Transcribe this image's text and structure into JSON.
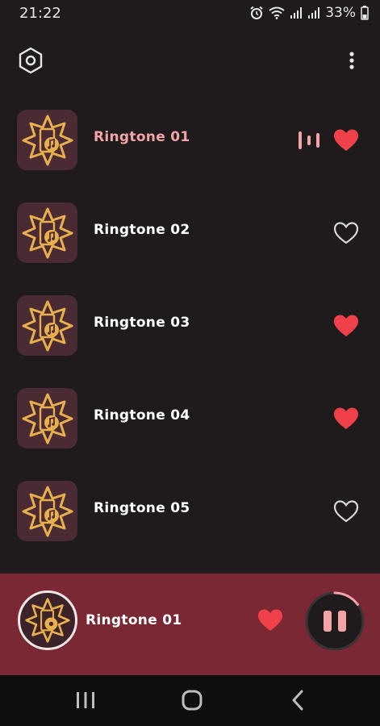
{
  "status_bar": {
    "time": "21:22",
    "battery": "33%",
    "icons": [
      "alarm-icon",
      "wifi-icon",
      "signal-icon",
      "signal-icon",
      "battery-icon"
    ]
  },
  "toolbar": {
    "settings_icon": "settings-hexagon-icon",
    "menu_icon": "more-vertical-icon"
  },
  "ringtones": [
    {
      "title": "Ringtone 01",
      "favorite": true,
      "playing": true
    },
    {
      "title": "Ringtone 02",
      "favorite": false,
      "playing": false
    },
    {
      "title": "Ringtone 03",
      "favorite": true,
      "playing": false
    },
    {
      "title": "Ringtone 04",
      "favorite": true,
      "playing": false
    },
    {
      "title": "Ringtone 05",
      "favorite": false,
      "playing": false
    }
  ],
  "player": {
    "title": "Ringtone 01",
    "favorite": true,
    "state": "playing",
    "progress": 0.15
  },
  "colors": {
    "background": "#1f1b1c",
    "thumb_bg": "#4a2a33",
    "accent_gold": "#e7b04c",
    "active_text": "#f4a3a6",
    "heart": "#f0404a",
    "player_bg": "#7a2834"
  }
}
